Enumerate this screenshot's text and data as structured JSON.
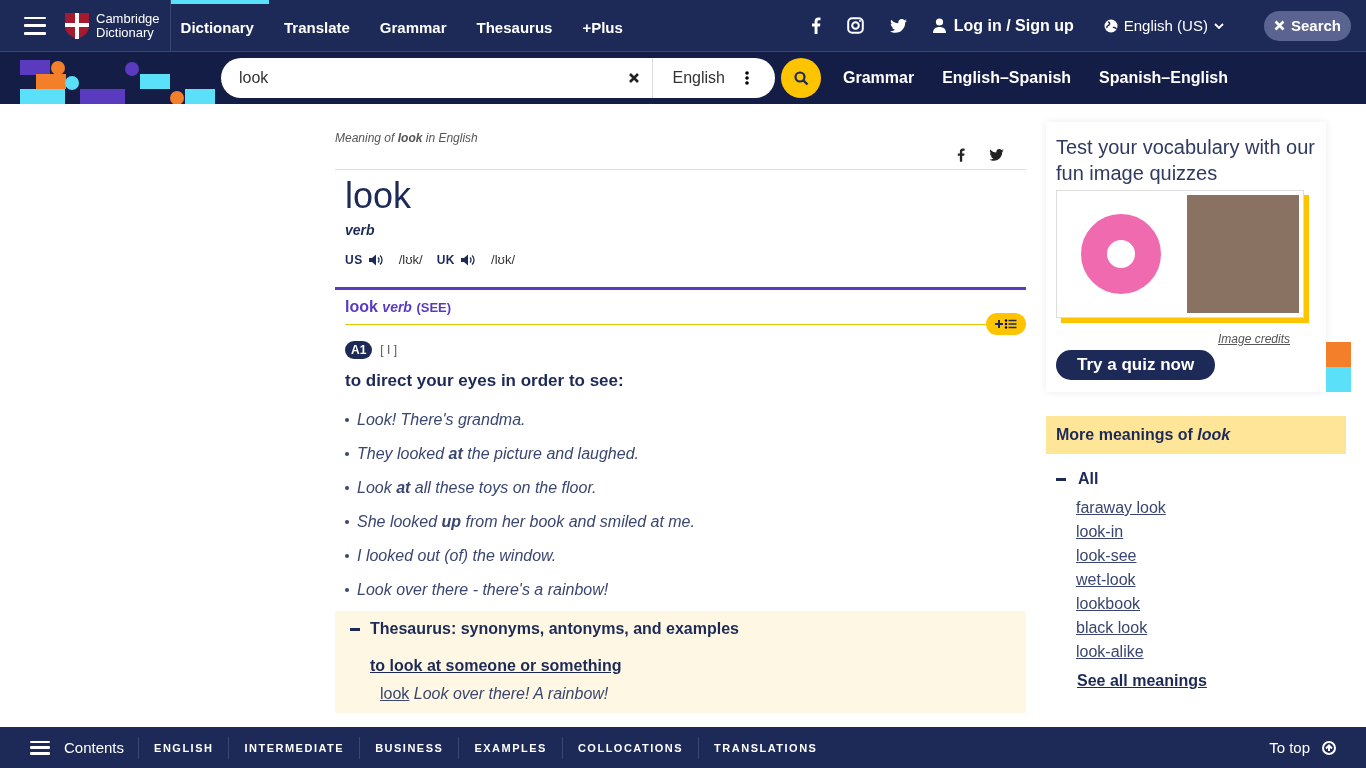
{
  "header": {
    "logo_text": [
      "Cambridge",
      "Dictionary"
    ],
    "nav": [
      {
        "label": "Dictionary",
        "selected": true
      },
      {
        "label": "Translate",
        "selected": false
      },
      {
        "label": "Grammar",
        "selected": false
      },
      {
        "label": "Thesaurus",
        "selected": false
      },
      {
        "label": "+Plus",
        "selected": false
      }
    ],
    "login": "Log in / Sign up",
    "language": "English (US)",
    "search_toggle": "Search"
  },
  "searchbar": {
    "value": "look",
    "dictionary": "English",
    "links": [
      "Grammar",
      "English–Spanish",
      "Spanish–English"
    ]
  },
  "entry": {
    "meaning_of": "Meaning of **look** in English",
    "headword": "look",
    "pos": "verb",
    "pronunciations": [
      {
        "region": "US",
        "ipa": "/lʊk/"
      },
      {
        "region": "UK",
        "ipa": "/lʊk/"
      }
    ],
    "sense": {
      "word": "look",
      "pos": "verb",
      "guide": "(SEE)",
      "level": "A1",
      "grammar": "[ I ]",
      "definition": "to direct your eyes in order to see:",
      "examples": [
        "Look! There's grandma.",
        "They looked **at** the picture and laughed.",
        "Look **at** all these toys on the floor.",
        "She looked **up** from her book and smiled at me.",
        "I looked out (of) the window.",
        "Look over there - there's a rainbow!"
      ]
    },
    "thesaurus": {
      "title": "Thesaurus: synonyms, antonyms, and examples",
      "expanded": true,
      "topic": "to look at someone or something",
      "word": "look",
      "example": "Look over there! A rainbow!"
    }
  },
  "quiz": {
    "title": "Test your vocabulary with our fun image quizzes",
    "credits": "Image credits",
    "button": "Try a quiz now"
  },
  "more_meanings": {
    "title": "More meanings of *look*",
    "group": {
      "label": "All",
      "expanded": true,
      "items": [
        "faraway look",
        "look-in",
        "look-see",
        "wet-look",
        "lookbook",
        "black look",
        "look-alike"
      ]
    },
    "see_all": "See all meanings"
  },
  "footer": {
    "contents": "Contents",
    "links": [
      "ENGLISH",
      "INTERMEDIATE",
      "BUSINESS",
      "EXAMPLES",
      "COLLOCATIONS",
      "TRANSLATIONS"
    ],
    "to_top": "To top"
  }
}
